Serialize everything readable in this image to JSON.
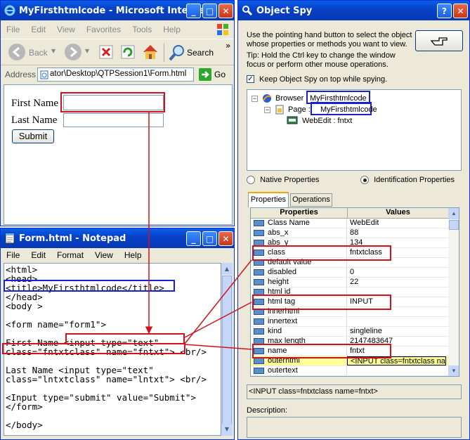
{
  "colors": {
    "highlight_red": "#d4101a",
    "highlight_blue": "#1820d0",
    "xp_blue": "#0842c8"
  },
  "ie": {
    "title": "MyFirsthtmlcode - Microsoft Interne...",
    "menu": [
      "File",
      "Edit",
      "View",
      "Favorites",
      "Tools",
      "Help"
    ],
    "toolbar": {
      "back": "Back",
      "search": "Search"
    },
    "address_label": "Address",
    "address_value": "ator\\Desktop\\QTPSession1\\Form.html",
    "go": "Go",
    "form": {
      "first_name": "First Name",
      "last_name": "Last Name",
      "submit": "Submit"
    }
  },
  "notepad": {
    "title": "Form.html - Notepad",
    "menu": [
      "File",
      "Edit",
      "Format",
      "View",
      "Help"
    ],
    "lines": [
      "<html>",
      "<head>",
      "<title>MyFirsthtmlcode</title>",
      "</head>",
      "<body >",
      "",
      "<form name=\"form1\">",
      "",
      "First Name <input type=\"text\"",
      "class=\"fntxtclass\" name=\"fntxt\"> <br/>",
      "",
      "Last Name <input type=\"text\"",
      "class=\"lntxtclass\" name=\"lntxt\"> <br/>",
      "",
      "<Input type=\"submit\" value=\"Submit\">",
      "</form>",
      "",
      "</body>"
    ]
  },
  "spy": {
    "title": "Object Spy",
    "instructions": "Use the pointing hand button to select the object whose properties or methods you want to view.",
    "tip": "Tip: Hold the Ctrl key to change the window focus or perform other mouse operations.",
    "keep_on_top": "Keep Object Spy on top while spying.",
    "tree": [
      {
        "type": "Browser",
        "name": "MyFirsthtmlcode"
      },
      {
        "type": "Page",
        "name": "MyFirsthtmlcode"
      },
      {
        "type": "WebEdit",
        "name": "fntxt"
      }
    ],
    "tree_labels": {
      "browser": "Browser :",
      "page": "Page :",
      "webedit": "WebEdit : fntxt"
    },
    "radio_native": "Native Properties",
    "radio_ident": "Identification Properties",
    "tabs": [
      "Properties",
      "Operations"
    ],
    "columns": [
      "Properties",
      "Values"
    ],
    "rows": [
      {
        "name": "Class Name",
        "value": "WebEdit"
      },
      {
        "name": "abs_x",
        "value": "88"
      },
      {
        "name": "abs_y",
        "value": "134"
      },
      {
        "name": "class",
        "value": "fntxtclass"
      },
      {
        "name": "default value",
        "value": ""
      },
      {
        "name": "disabled",
        "value": "0"
      },
      {
        "name": "height",
        "value": "22"
      },
      {
        "name": "html id",
        "value": ""
      },
      {
        "name": "html tag",
        "value": "INPUT"
      },
      {
        "name": "innerhtml",
        "value": ""
      },
      {
        "name": "innertext",
        "value": ""
      },
      {
        "name": "kind",
        "value": "singleline"
      },
      {
        "name": "max length",
        "value": "2147483647"
      },
      {
        "name": "name",
        "value": "fntxt"
      },
      {
        "name": "outerhtml",
        "value": "<INPUT class=fntxtclass na"
      },
      {
        "name": "outertext",
        "value": ""
      }
    ],
    "detail_value": "<INPUT class=fntxtclass name=fntxt>",
    "description_label": "Description:"
  }
}
